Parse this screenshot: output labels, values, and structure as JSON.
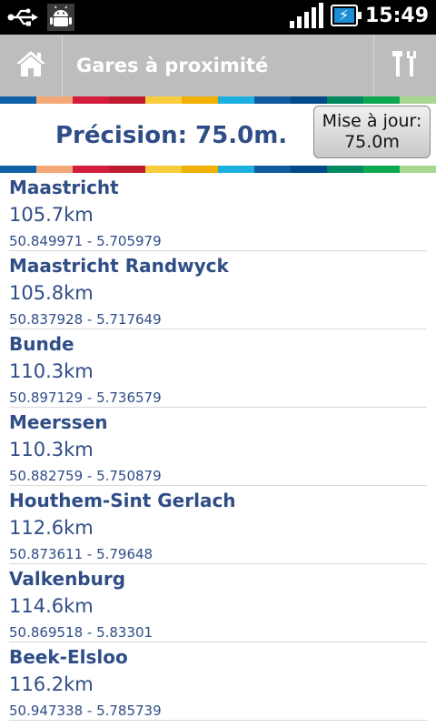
{
  "status_bar": {
    "time": "15:49",
    "icons": [
      "usb-icon",
      "android-debug-icon",
      "signal-icon",
      "battery-charging-icon"
    ],
    "signal_level": 1.0
  },
  "header": {
    "title": "Gares à proximité",
    "home_icon": "home-icon",
    "settings_icon": "tools-icon"
  },
  "stripe_colors": [
    "#1060a8",
    "#f4a878",
    "#d41c3c",
    "#c01c30",
    "#f8cc3c",
    "#f0b000",
    "#1cb0e0",
    "#105aa0",
    "#004a88",
    "#008860",
    "#0ca850",
    "#a8d890"
  ],
  "precision": {
    "label": "Précision: 75.0m.",
    "button_line1": "Mise à jour:",
    "button_line2": "75.0m"
  },
  "stations": [
    {
      "name": "Maastricht",
      "distance": "105.7km",
      "coords": "50.849971 - 5.705979"
    },
    {
      "name": "Maastricht Randwyck",
      "distance": "105.8km",
      "coords": "50.837928 - 5.717649"
    },
    {
      "name": "Bunde",
      "distance": "110.3km",
      "coords": "50.897129 - 5.736579"
    },
    {
      "name": "Meerssen",
      "distance": "110.3km",
      "coords": "50.882759 - 5.750879"
    },
    {
      "name": "Houthem-Sint Gerlach",
      "distance": "112.6km",
      "coords": "50.873611 - 5.79648"
    },
    {
      "name": "Valkenburg",
      "distance": "114.6km",
      "coords": "50.869518 - 5.83301"
    },
    {
      "name": "Beek-Elsloo",
      "distance": "116.2km",
      "coords": "50.947338 - 5.785739"
    }
  ],
  "colors": {
    "text_accent": "#2f4d86",
    "action_bar": "#bdbdbd"
  }
}
